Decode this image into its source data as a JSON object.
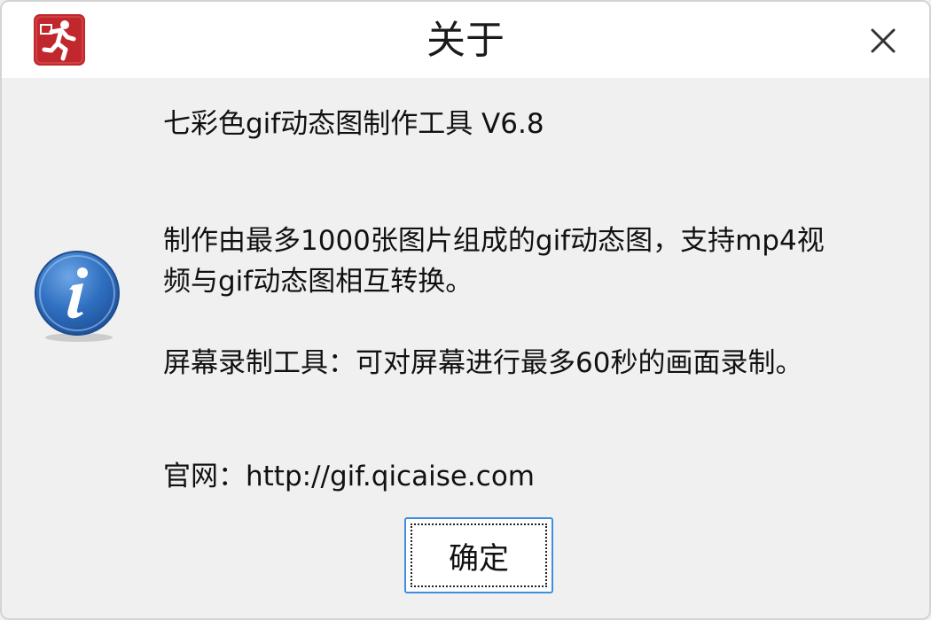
{
  "window": {
    "title": "关于",
    "app_icon": "running-man-icon",
    "close_icon": "close-icon"
  },
  "content": {
    "icon": "info-icon",
    "product_line": "七彩色gif动态图制作工具 V6.8",
    "description_line1": "制作由最多1000张图片组成的gif动态图，支持mp4视",
    "description_line2": "频与gif动态图相互转换。",
    "screen_record_line": "屏幕录制工具：可对屏幕进行最多60秒的画面录制。",
    "website_line": "官网：http://gif.qicaise.com"
  },
  "buttons": {
    "ok_label": "确定"
  },
  "colors": {
    "app_icon_red": "#c0282d",
    "info_blue": "#2f6fc0",
    "focus_border": "#3f8fe0"
  }
}
